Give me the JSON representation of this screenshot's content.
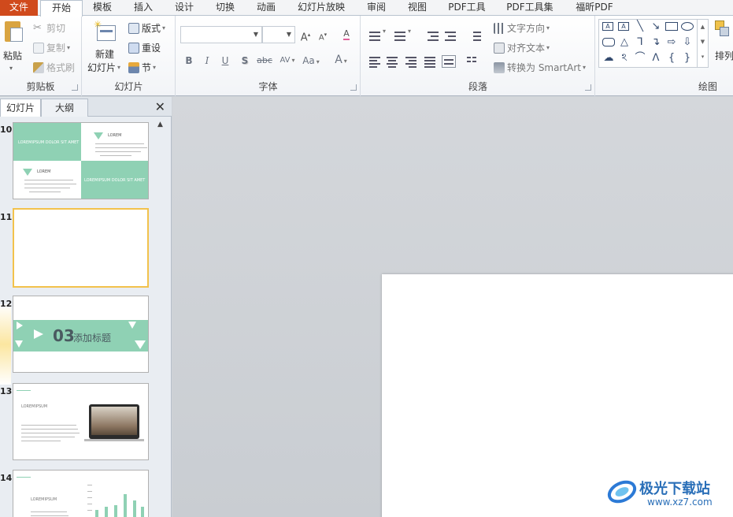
{
  "tabs": [
    "文件",
    "开始",
    "模板",
    "插入",
    "设计",
    "切换",
    "动画",
    "幻灯片放映",
    "审阅",
    "视图",
    "PDF工具",
    "PDF工具集",
    "福昕PDF"
  ],
  "ribbon": {
    "clipboard": {
      "paste": "粘贴",
      "cut": "剪切",
      "copy": "复制",
      "format_painter": "格式刷",
      "label": "剪贴板"
    },
    "slides": {
      "new_slide_line1": "新建",
      "new_slide_line2": "幻灯片",
      "layout": "版式",
      "reset": "重设",
      "section": "节",
      "label": "幻灯片"
    },
    "font": {
      "label": "字体",
      "font_name": "",
      "font_size": "",
      "bold": "B",
      "italic": "I",
      "underline": "U",
      "shadow": "S",
      "strike": "abc",
      "spacing": "AV",
      "case": "Aa",
      "grow": "A",
      "shrink": "A",
      "clear": "A",
      "color": "A"
    },
    "paragraph": {
      "label": "段落",
      "text_direction": "文字方向",
      "align_text": "对齐文本",
      "smartart": "转换为 SmartArt"
    },
    "drawing": {
      "label": "绘图",
      "arrange": "排列"
    }
  },
  "panel": {
    "tab_slides": "幻灯片",
    "tab_outline": "大纲",
    "close": "✕"
  },
  "slides": [
    {
      "num": "10",
      "heading1": "LOREMIPSUM DOLOR SIT AMET",
      "heading2": "LOREM",
      "heading3": "LOREM",
      "heading4": "LOREMIPSUM DOLOR SIT AMET"
    },
    {
      "num": "11"
    },
    {
      "num": "12",
      "number": "03",
      "title": "添加标题"
    },
    {
      "num": "13",
      "heading": "LOREMIPSUM"
    },
    {
      "num": "14",
      "heading": "LOREMIPSUM"
    }
  ],
  "colors": {
    "file_tab": "#d04a1c",
    "accent": "#8fd1b4",
    "selected_border": "#f2c24c"
  },
  "watermark": {
    "name": "极光下载站",
    "url": "www.xz7.com"
  }
}
